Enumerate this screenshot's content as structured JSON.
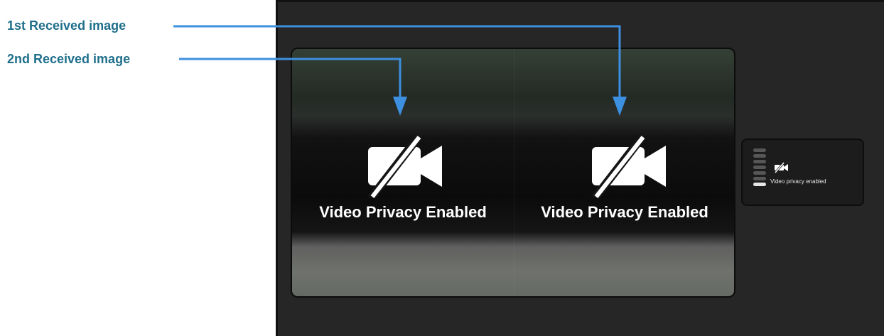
{
  "callouts": {
    "first": "1st Received image",
    "second": "2nd Received image"
  },
  "video": {
    "left_pane": {
      "status": "Video Privacy Enabled",
      "icon": "video-off-icon"
    },
    "right_pane": {
      "status": "Video Privacy Enabled",
      "icon": "video-off-icon"
    }
  },
  "self_view": {
    "status": "Video privacy enabled",
    "icon": "video-off-icon",
    "audio_level": 0.14
  },
  "colors": {
    "callout_text": "#1f6f8b",
    "arrow": "#3d8fe0",
    "screen_bg": "#262626"
  }
}
